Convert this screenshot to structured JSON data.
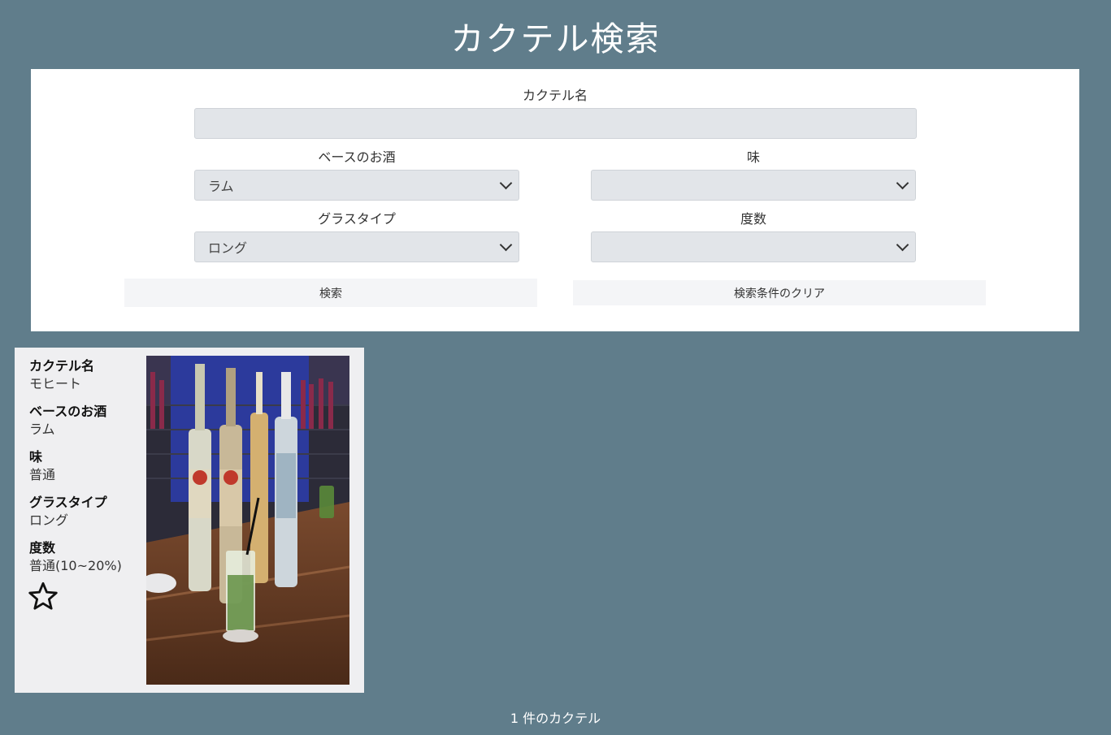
{
  "header": {
    "title": "カクテル検索"
  },
  "search": {
    "name_label": "カクテル名",
    "name_value": "",
    "base_label": "ベースのお酒",
    "base_value": "ラム",
    "taste_label": "味",
    "taste_value": "",
    "glass_label": "グラスタイプ",
    "glass_value": "ロング",
    "strength_label": "度数",
    "strength_value": "",
    "search_button": "検索",
    "clear_button": "検索条件のクリア"
  },
  "results": [
    {
      "name_label": "カクテル名",
      "name": "モヒート",
      "base_label": "ベースのお酒",
      "base": "ラム",
      "taste_label": "味",
      "taste": "普通",
      "glass_label": "グラスタイプ",
      "glass": "ロング",
      "strength_label": "度数",
      "strength": "普通(10~20%)",
      "favorite_icon": "star-outline-icon"
    }
  ],
  "footer": {
    "count_text": "1 件のカクテル"
  }
}
